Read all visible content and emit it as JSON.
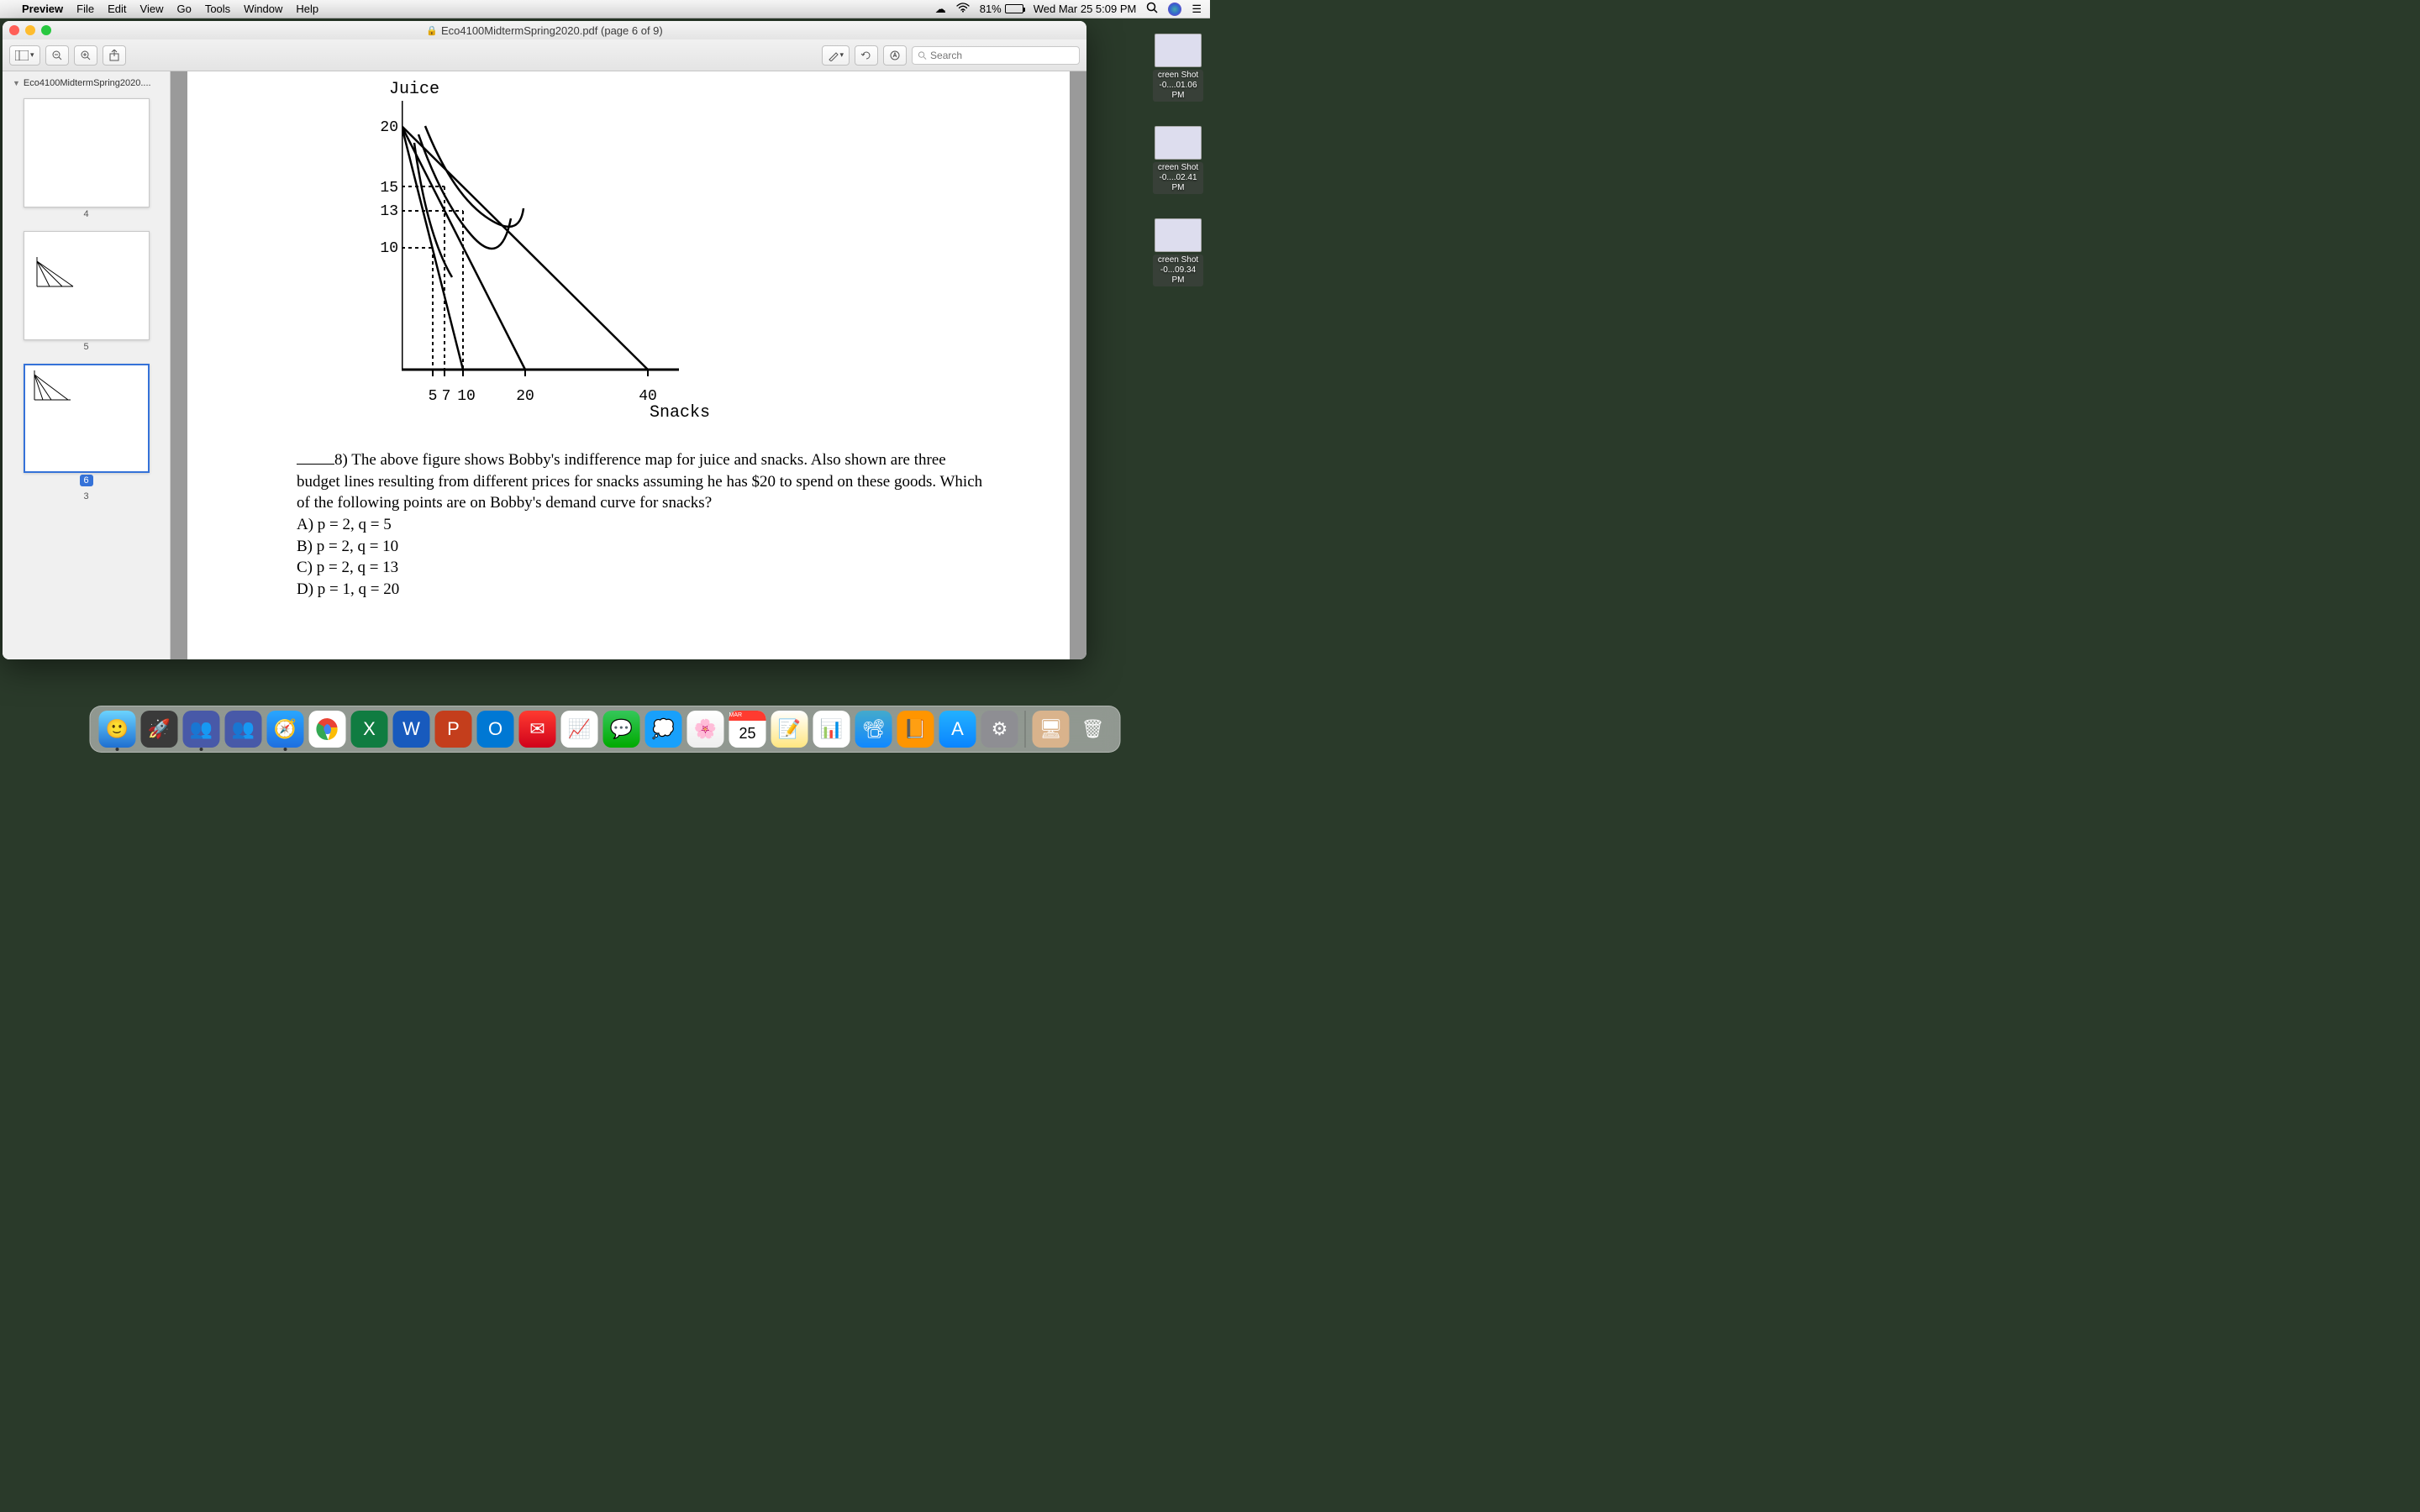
{
  "menubar": {
    "app": "Preview",
    "items": [
      "File",
      "Edit",
      "View",
      "Go",
      "Tools",
      "Window",
      "Help"
    ],
    "battery_pct": "81%",
    "datetime": "Wed Mar 25  5:09 PM"
  },
  "window": {
    "title": "Eco4100MidtermSpring2020.pdf (page 6 of 9)",
    "sidebar_doc": "Eco4100MidtermSpring2020....",
    "thumbnails": [
      "4",
      "5",
      "6",
      "3"
    ],
    "current_page": "6"
  },
  "toolbar": {
    "search_placeholder": "Search"
  },
  "question": {
    "num": "8)",
    "text": "The above figure shows Bobby's indifference map for juice and snacks. Also shown are three budget lines resulting from different prices for snacks assuming he has $20 to spend on these goods. Which of the following points are on Bobby's demand curve for snacks?",
    "optA": "A) p = 2, q = 5",
    "optB": "B) p = 2, q = 10",
    "optC": "C) p = 2, q = 13",
    "optD": "D) p = 1, q = 20"
  },
  "chart_data": {
    "type": "line",
    "title": "",
    "xlabel": "Snacks",
    "ylabel": "Juice",
    "y_ticks": [
      10,
      13,
      15,
      20
    ],
    "x_ticks": [
      5,
      7,
      10,
      20,
      40
    ],
    "xlim": [
      0,
      45
    ],
    "ylim": [
      0,
      22
    ],
    "series": [
      {
        "name": "budget-line-1",
        "x": [
          0,
          10
        ],
        "y": [
          20,
          0
        ]
      },
      {
        "name": "budget-line-2",
        "x": [
          0,
          20
        ],
        "y": [
          20,
          0
        ]
      },
      {
        "name": "budget-line-3",
        "x": [
          0,
          40
        ],
        "y": [
          20,
          0
        ]
      },
      {
        "name": "guide-h-15",
        "x": [
          0,
          7
        ],
        "y": [
          15,
          15
        ],
        "style": "dash"
      },
      {
        "name": "guide-h-13",
        "x": [
          0,
          10
        ],
        "y": [
          13,
          13
        ],
        "style": "dash"
      },
      {
        "name": "guide-h-10",
        "x": [
          0,
          5
        ],
        "y": [
          10,
          10
        ],
        "style": "dash"
      },
      {
        "name": "guide-v-5",
        "x": [
          5,
          5
        ],
        "y": [
          0,
          10
        ],
        "style": "dash"
      },
      {
        "name": "guide-v-7",
        "x": [
          7,
          7
        ],
        "y": [
          0,
          15
        ],
        "style": "dash"
      },
      {
        "name": "guide-v-10",
        "x": [
          10,
          10
        ],
        "y": [
          0,
          13
        ],
        "style": "dash"
      }
    ],
    "indifference_curves": 3
  },
  "desktop_files": [
    {
      "name": "creen Shot",
      "sub": "-0....01.06 PM"
    },
    {
      "name": "creen Shot",
      "sub": "-0....02.41 PM"
    },
    {
      "name": "creen Shot",
      "sub": "-0...09.34 PM"
    }
  ],
  "dock_items": [
    "Finder",
    "Launchpad",
    "Team1",
    "Team2",
    "Safari",
    "Chrome",
    "Excel",
    "Word",
    "PowerPoint",
    "Outlook",
    "Mail",
    "Stocks",
    "Messages",
    "Chat",
    "Photos",
    "Calendar",
    "Notes",
    "Numbers",
    "Keynote",
    "Books",
    "AppStore",
    "Settings",
    "ScreenShare",
    "Trash"
  ],
  "calendar_badge": {
    "month": "MAR",
    "day": "25"
  }
}
